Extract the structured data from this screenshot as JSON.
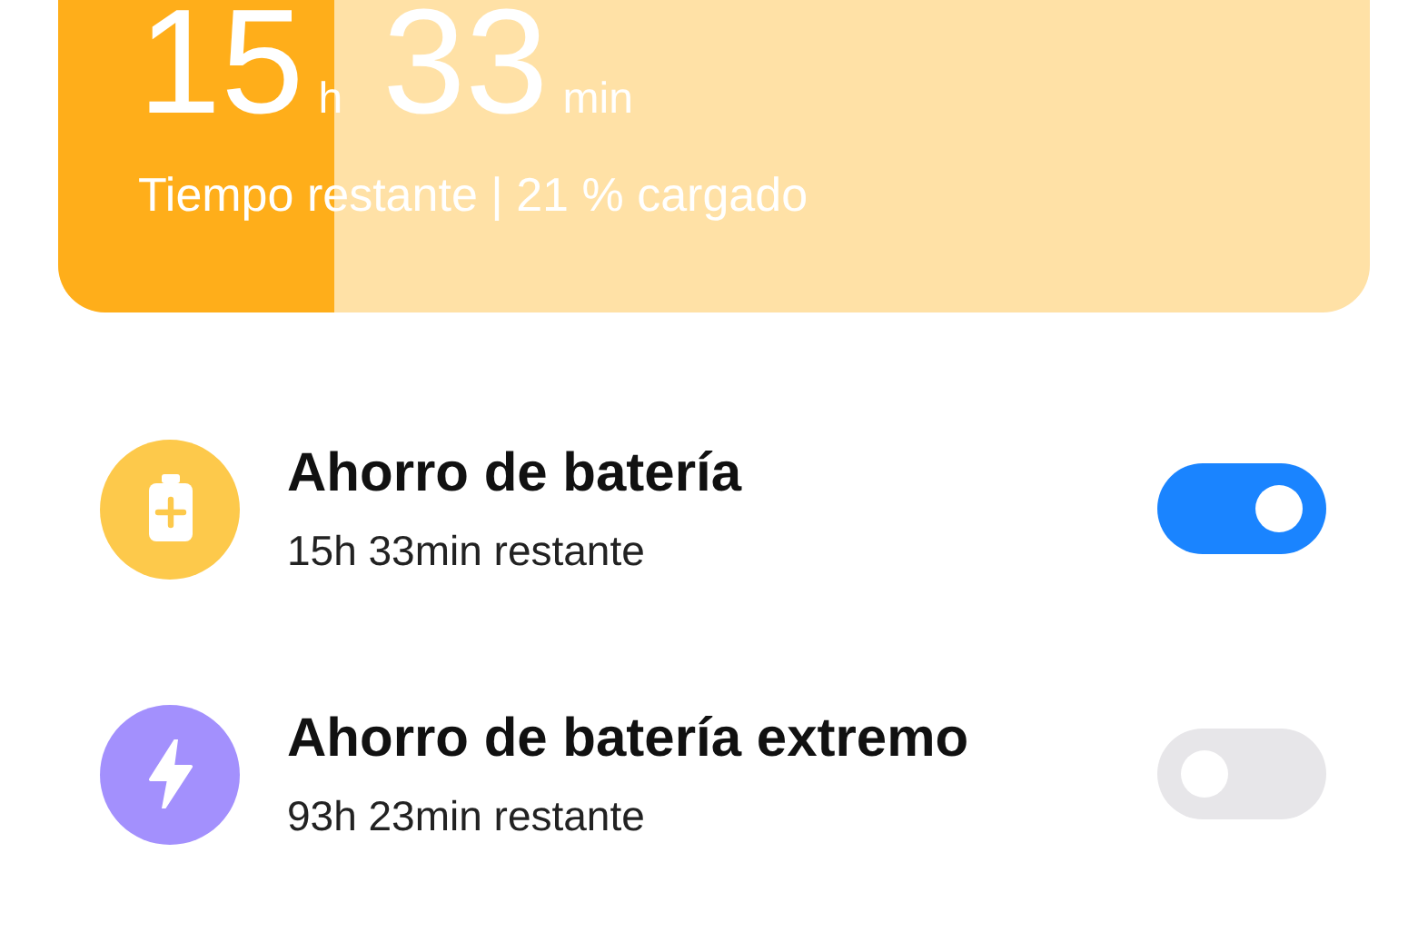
{
  "battery_card": {
    "hours": "15",
    "hours_unit": "h",
    "minutes": "33",
    "minutes_unit": "min",
    "caption": "Tiempo restante | 21 % cargado",
    "level": 0.21
  },
  "modes": [
    {
      "kind": "saver",
      "title": "Ahorro de batería",
      "subtitle": "15h 33min restante",
      "on": true
    },
    {
      "kind": "extreme",
      "title": "Ahorro de batería extremo",
      "subtitle": "93h 23min restante",
      "on": false
    }
  ]
}
